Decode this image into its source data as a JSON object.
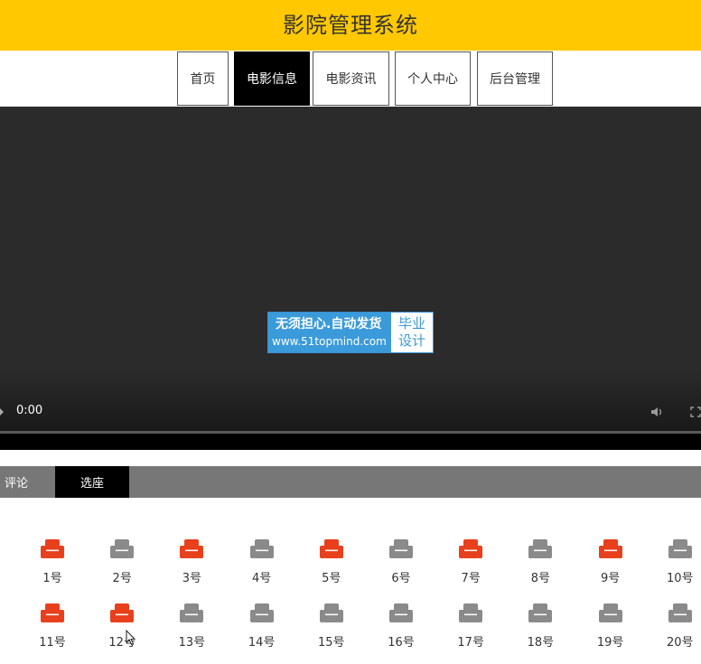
{
  "header": {
    "title": "影院管理系统"
  },
  "nav": {
    "items": [
      {
        "label": "首页",
        "active": false
      },
      {
        "label": "电影信息",
        "active": true
      },
      {
        "label": "电影资讯",
        "active": false
      },
      {
        "label": "个人中心",
        "active": false
      },
      {
        "label": "后台管理",
        "active": false
      }
    ]
  },
  "video": {
    "time": "0:00",
    "progress": 0,
    "watermark": {
      "line1": "无须担心.自动发货",
      "line2": "www.51topmind.com",
      "side1": "毕业",
      "side2": "设计"
    }
  },
  "tabs": {
    "items": [
      {
        "label": "评论",
        "active": false
      },
      {
        "label": "选座",
        "active": true
      }
    ]
  },
  "seats": [
    {
      "label": "1号",
      "taken": true
    },
    {
      "label": "2号",
      "taken": false
    },
    {
      "label": "3号",
      "taken": true
    },
    {
      "label": "4号",
      "taken": false
    },
    {
      "label": "5号",
      "taken": true
    },
    {
      "label": "6号",
      "taken": false
    },
    {
      "label": "7号",
      "taken": true
    },
    {
      "label": "8号",
      "taken": false
    },
    {
      "label": "9号",
      "taken": true
    },
    {
      "label": "10号",
      "taken": false
    },
    {
      "label": "11号",
      "taken": true
    },
    {
      "label": "12号",
      "taken": true
    },
    {
      "label": "13号",
      "taken": false
    },
    {
      "label": "14号",
      "taken": false
    },
    {
      "label": "15号",
      "taken": false
    },
    {
      "label": "16号",
      "taken": false
    },
    {
      "label": "17号",
      "taken": false
    },
    {
      "label": "18号",
      "taken": false
    },
    {
      "label": "19号",
      "taken": false
    },
    {
      "label": "20号",
      "taken": false
    }
  ],
  "colors": {
    "header_bg": "#ffc800",
    "seat_taken": "#e8401c",
    "seat_free": "#8a8a8a",
    "tab_bar": "#777777"
  }
}
